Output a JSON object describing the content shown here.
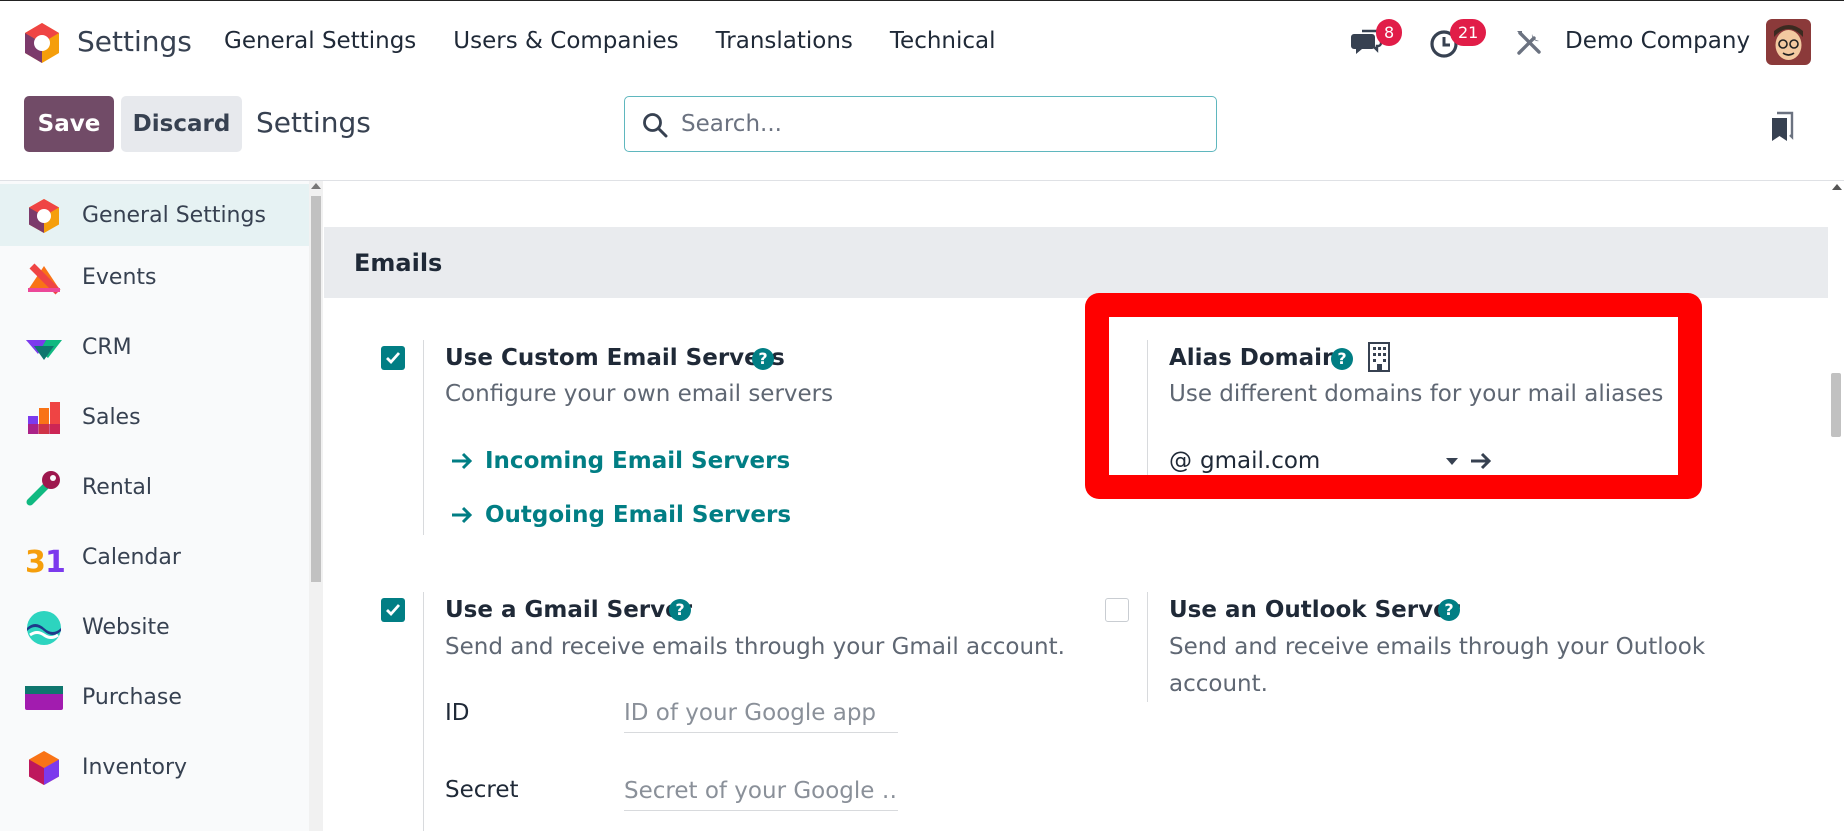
{
  "navbar": {
    "app_title": "Settings",
    "menu": [
      "General Settings",
      "Users & Companies",
      "Translations",
      "Technical"
    ],
    "messages_count": "8",
    "activities_count": "21",
    "company": "Demo Company"
  },
  "control_panel": {
    "save_label": "Save",
    "discard_label": "Discard",
    "title": "Settings",
    "search_placeholder": "Search..."
  },
  "sidebar": {
    "items": [
      {
        "label": "General Settings",
        "icon": "odoo-logo-icon",
        "active": true
      },
      {
        "label": "Events",
        "icon": "events-icon"
      },
      {
        "label": "CRM",
        "icon": "crm-icon"
      },
      {
        "label": "Sales",
        "icon": "sales-icon"
      },
      {
        "label": "Rental",
        "icon": "rental-icon"
      },
      {
        "label": "Calendar",
        "icon": "calendar-icon"
      },
      {
        "label": "Website",
        "icon": "website-icon"
      },
      {
        "label": "Purchase",
        "icon": "purchase-icon"
      },
      {
        "label": "Inventory",
        "icon": "inventory-icon"
      }
    ]
  },
  "emails": {
    "section_title": "Emails",
    "custom_servers": {
      "title": "Use Custom Email Servers",
      "checked": true,
      "description": "Configure your own email servers",
      "incoming_link": "Incoming Email Servers",
      "outgoing_link": "Outgoing Email Servers"
    },
    "alias_domain": {
      "title": "Alias Domain",
      "description": "Use different domains for your mail aliases",
      "at_symbol": "@",
      "value": "gmail.com"
    },
    "gmail": {
      "title": "Use a Gmail Server",
      "checked": true,
      "description": "Send and receive emails through your Gmail account.",
      "id_label": "ID",
      "id_placeholder": "ID of your Google app",
      "secret_label": "Secret",
      "secret_placeholder": "Secret of your Google …"
    },
    "outlook": {
      "title": "Use an Outlook Server",
      "checked": false,
      "description": "Send and receive emails through your Outlook account."
    }
  },
  "colors": {
    "primary": "#714b67",
    "accent": "#017e84",
    "badge": "#e11d48",
    "highlight": "#ff0000"
  }
}
